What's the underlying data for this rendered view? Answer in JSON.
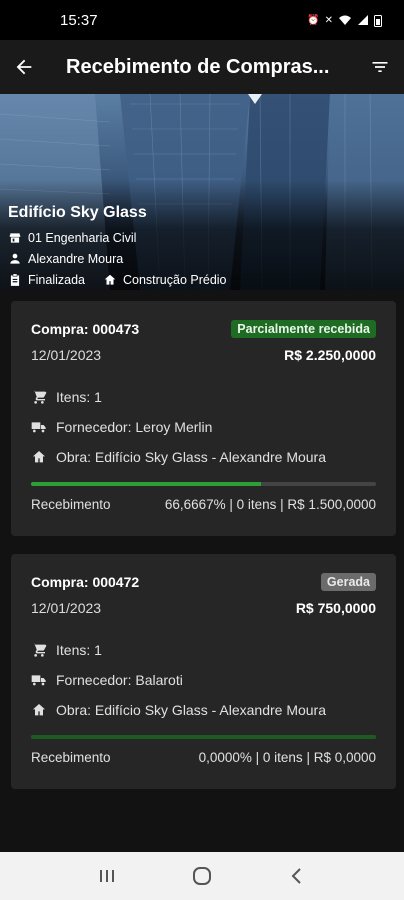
{
  "status_bar": {
    "time": "15:37"
  },
  "app_bar": {
    "title": "Recebimento de Compras..."
  },
  "project": {
    "name": "Edifício Sky Glass",
    "company": "01 Engenharia Civil",
    "user": "Alexandre Moura",
    "status": "Finalizada",
    "type": "Construção Prédio"
  },
  "purchases": [
    {
      "number": "Compra: 000473",
      "badge": "Parcialmente recebida",
      "date": "12/01/2023",
      "total": "R$ 2.250,0000",
      "items": "Itens: 1",
      "supplier": "Fornecedor: Leroy Merlin",
      "work": "Obra: Edifício Sky Glass - Alexandre Moura",
      "progress": 0.666667,
      "receipt_label": "Recebimento",
      "receipt_summary": "66,6667% | 0 itens | R$ 1.500,0000"
    },
    {
      "number": "Compra: 000472",
      "badge": "Gerada",
      "date": "12/01/2023",
      "total": "R$ 750,0000",
      "items": "Itens: 1",
      "supplier": "Fornecedor: Balaroti",
      "work": "Obra: Edifício Sky Glass - Alexandre Moura",
      "progress": 0.0,
      "receipt_label": "Recebimento",
      "receipt_summary": "0,0000% | 0 itens | R$ 0,0000"
    }
  ],
  "colors": {
    "badge_partial": "#1e6b23",
    "badge_generated": "#6b6b6b",
    "progress": "#2e9e36"
  }
}
